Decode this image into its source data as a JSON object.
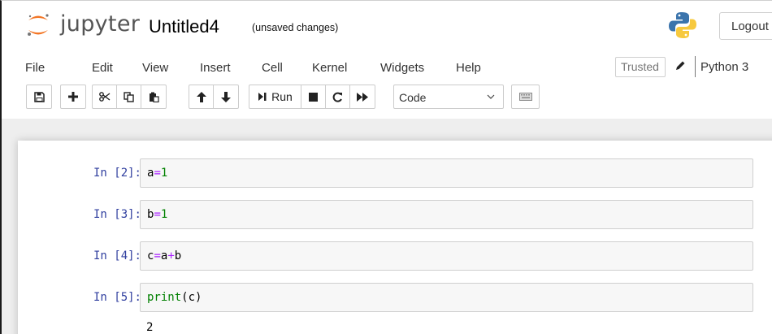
{
  "header": {
    "brand": "jupyter",
    "notebook_name": "Untitled4",
    "status": "(unsaved changes)",
    "logout_label": "Logout"
  },
  "menubar": {
    "items": [
      "File",
      "Edit",
      "View",
      "Insert",
      "Cell",
      "Kernel",
      "Widgets",
      "Help"
    ],
    "trusted_label": "Trusted",
    "kernel_name": "Python 3"
  },
  "toolbar": {
    "run_label": "Run",
    "cell_type": "Code",
    "icons": [
      "save-icon",
      "plus-icon",
      "scissors-icon",
      "copy-icon",
      "paste-icon",
      "arrow-up-icon",
      "arrow-down-icon",
      "run-icon",
      "stop-icon",
      "restart-icon",
      "fast-forward-icon",
      "chevron-down-icon",
      "keyboard-icon"
    ]
  },
  "cells": [
    {
      "prompt": "In [2]:",
      "parts": [
        "a",
        "=",
        "1"
      ]
    },
    {
      "prompt": "In [3]:",
      "parts": [
        "b",
        "=",
        "1"
      ]
    },
    {
      "prompt": "In [4]:",
      "parts": [
        "c",
        "=",
        "a",
        "+",
        "b"
      ]
    },
    {
      "prompt": "In [5]:",
      "parts": [
        "print",
        "(c)"
      ]
    }
  ],
  "output": "2",
  "colors": {
    "prompt": "#303f9f",
    "operator": "#aa22ff",
    "number": "#008000",
    "builtin": "#008000",
    "logo_orange": "#f37626"
  }
}
